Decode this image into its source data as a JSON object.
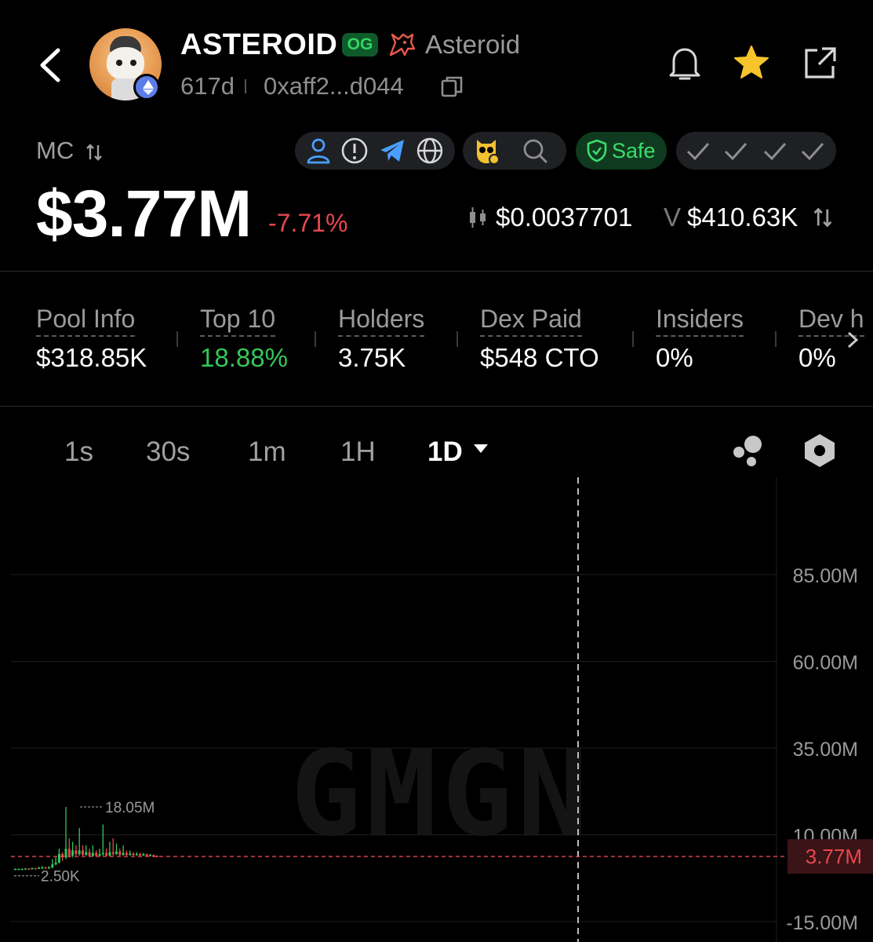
{
  "header": {
    "token_name": "ASTEROID",
    "og_badge": "OG",
    "platform_name": "Asteroid",
    "age": "617d",
    "address": "0xaff2...d044",
    "icons": [
      "back-icon",
      "token-avatar",
      "ethereum-icon",
      "unicorn-icon",
      "copy-icon",
      "bell-icon",
      "star-icon",
      "share-icon"
    ]
  },
  "market": {
    "mc_label": "MC",
    "market_cap": "$3.77M",
    "change": "-7.71%",
    "price": "$0.0037701",
    "volume_label": "V",
    "volume": "$410.63K",
    "safe_label": "Safe",
    "chips": [
      "user-icon",
      "info-icon",
      "telegram-icon",
      "website-icon",
      "owl-icon",
      "search-icon",
      "shield-check-icon",
      "check-icon",
      "check-icon",
      "check-icon",
      "check-icon"
    ]
  },
  "stats": [
    {
      "label": "Pool Info",
      "value": "$318.85K",
      "color": "#ffffff"
    },
    {
      "label": "Top 10",
      "value": "18.88%",
      "color": "#34c759"
    },
    {
      "label": "Holders",
      "value": "3.75K",
      "color": "#ffffff"
    },
    {
      "label": "Dex Paid",
      "value": "$548 CTO",
      "color": "#ffffff"
    },
    {
      "label": "Insiders",
      "value": "0%",
      "color": "#ffffff"
    },
    {
      "label": "Dev h",
      "value": "0%",
      "color": "#ffffff"
    }
  ],
  "timeframes": {
    "items": [
      "1s",
      "30s",
      "1m",
      "1H",
      "1D"
    ],
    "active": "1D"
  },
  "colors": {
    "up": "#34c759",
    "down": "#e8474f",
    "background": "#000000"
  },
  "chart_data": {
    "type": "candlestick",
    "watermark": "GMGN",
    "y_ticks": [
      "85.00M",
      "60.00M",
      "35.00M",
      "10.00M",
      "-15.00M"
    ],
    "y_tick_values": [
      85,
      60,
      35,
      10,
      -15
    ],
    "current_value_label": "3.77M",
    "current_value": 3.77,
    "high_label": "18.05M",
    "high_value": 18.05,
    "low_label": "2.50K",
    "low_value": 0.0025,
    "candles": [
      [
        0.2,
        0.2,
        0.3,
        0.1
      ],
      [
        0.2,
        0.2,
        0.3,
        0.1
      ],
      [
        0.2,
        0.2,
        0.3,
        0.1
      ],
      [
        0.2,
        0.3,
        0.4,
        0.1
      ],
      [
        0.3,
        0.2,
        0.4,
        0.1
      ],
      [
        0.2,
        0.4,
        0.6,
        0.1
      ],
      [
        0.4,
        0.3,
        0.5,
        0.2
      ],
      [
        0.3,
        0.5,
        0.8,
        0.2
      ],
      [
        0.5,
        0.6,
        1.0,
        0.3
      ],
      [
        0.6,
        0.4,
        0.8,
        0.3
      ],
      [
        0.4,
        0.6,
        1.0,
        0.3
      ],
      [
        0.6,
        1.5,
        3.0,
        0.4
      ],
      [
        1.5,
        2.0,
        3.5,
        1.2
      ],
      [
        2.0,
        4.5,
        6.0,
        1.8
      ],
      [
        4.5,
        3.5,
        5.0,
        2.5
      ],
      [
        3.5,
        6.0,
        18.05,
        3.0
      ],
      [
        6.0,
        4.0,
        9.0,
        3.5
      ],
      [
        4.0,
        5.5,
        8.0,
        3.5
      ],
      [
        5.5,
        4.5,
        7.0,
        4.0
      ],
      [
        4.5,
        5.5,
        12.0,
        4.0
      ],
      [
        5.5,
        4.2,
        7.0,
        4.0
      ],
      [
        4.2,
        5.0,
        7.0,
        4.0
      ],
      [
        5.0,
        4.0,
        6.0,
        3.8
      ],
      [
        4.0,
        4.8,
        7.0,
        3.7
      ],
      [
        4.8,
        4.0,
        5.5,
        3.8
      ],
      [
        4.0,
        4.5,
        6.0,
        3.7
      ],
      [
        4.5,
        4.8,
        13.0,
        4.0
      ],
      [
        4.8,
        4.0,
        6.0,
        3.8
      ],
      [
        4.0,
        5.0,
        8.0,
        3.8
      ],
      [
        5.0,
        4.5,
        9.0,
        4.0
      ],
      [
        4.5,
        5.2,
        7.5,
        4.2
      ],
      [
        5.2,
        4.2,
        6.0,
        4.0
      ],
      [
        4.2,
        4.8,
        7.0,
        4.0
      ],
      [
        4.8,
        4.2,
        5.5,
        4.0
      ],
      [
        4.2,
        4.6,
        5.5,
        4.0
      ],
      [
        4.6,
        4.2,
        5.0,
        4.0
      ],
      [
        4.2,
        4.5,
        5.0,
        4.0
      ],
      [
        4.5,
        4.1,
        4.8,
        3.9
      ],
      [
        4.1,
        4.4,
        4.8,
        3.9
      ],
      [
        4.4,
        4.0,
        4.6,
        3.8
      ],
      [
        4.0,
        4.2,
        4.5,
        3.8
      ],
      [
        4.2,
        3.9,
        4.3,
        3.7
      ],
      [
        3.9,
        3.8,
        4.1,
        3.6
      ]
    ]
  }
}
